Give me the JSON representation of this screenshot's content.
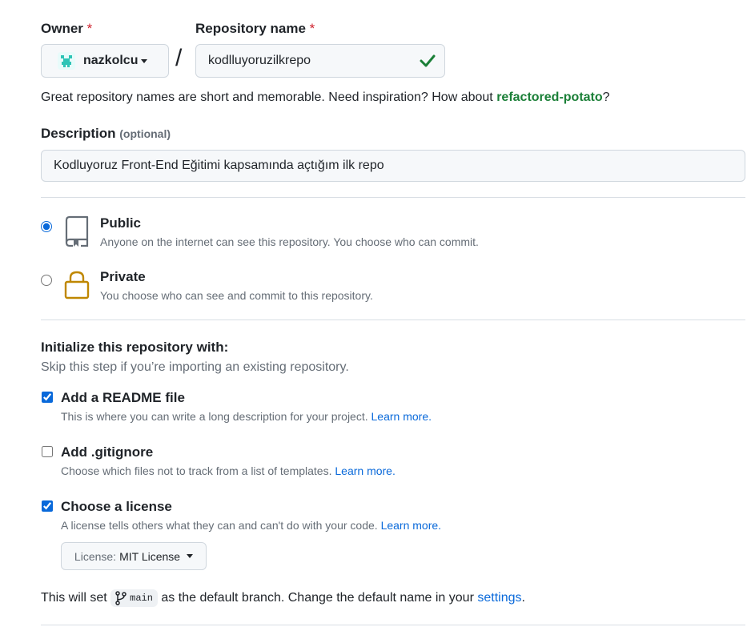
{
  "owner": {
    "label": "Owner",
    "required_mark": "*",
    "value": "nazkolcu"
  },
  "slash": "/",
  "repo_name": {
    "label": "Repository name",
    "required_mark": "*",
    "value": "kodlluyoruzilkrepo",
    "valid_icon": "check-icon"
  },
  "name_help": {
    "text": "Great repository names are short and memorable. Need inspiration? How about ",
    "suggestion": "refactored-potato",
    "end": "?"
  },
  "description": {
    "label": "Description",
    "optional": "(optional)",
    "value": "Kodluyoruz Front-End Eğitimi kapsamında açtığım ilk repo"
  },
  "visibility": {
    "options": [
      {
        "title": "Public",
        "desc": "Anyone on the internet can see this repository. You choose who can commit.",
        "icon": "repo-icon",
        "selected": true
      },
      {
        "title": "Private",
        "desc": "You choose who can see and commit to this repository.",
        "icon": "lock-icon",
        "selected": false
      }
    ]
  },
  "init": {
    "title": "Initialize this repository with:",
    "subtitle": "Skip this step if you’re importing an existing repository.",
    "items": [
      {
        "title": "Add a README file",
        "desc": "This is where you can write a long description for your project.",
        "link": "Learn more.",
        "checked": true
      },
      {
        "title": "Add .gitignore",
        "desc": "Choose which files not to track from a list of templates.",
        "link": "Learn more.",
        "checked": false
      },
      {
        "title": "Choose a license",
        "desc": "A license tells others what they can and can't do with your code.",
        "link": "Learn more.",
        "checked": true
      }
    ],
    "license_prefix": "License:",
    "license_value": "MIT License"
  },
  "branch": {
    "prefix": "This will set",
    "branch_name": "main",
    "middle": "as the default branch. Change the default name in your",
    "link": "settings",
    "end": "."
  },
  "colors": {
    "accent_blue": "#0969da",
    "success_green": "#1a7f37",
    "required_red": "#cf222e",
    "lock_gold": "#bf8700"
  }
}
